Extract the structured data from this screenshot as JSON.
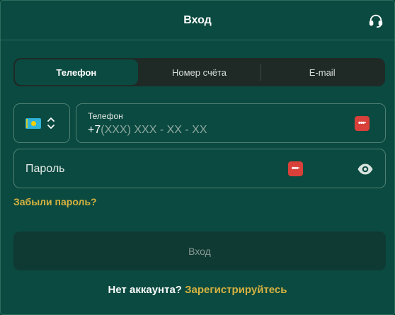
{
  "header": {
    "title": "Вход",
    "support_icon": "headset-icon"
  },
  "tabs": [
    {
      "label": "Телефон",
      "active": true
    },
    {
      "label": "Номер счёта",
      "active": false
    },
    {
      "label": "E-mail",
      "active": false
    }
  ],
  "country_select": {
    "flag": "kazakhstan-flag",
    "icon": "chevron-updown-icon"
  },
  "phone_field": {
    "label": "Телефон",
    "prefix": "+7",
    "mask": "(XXX) XXX - XX - XX",
    "manager_icon": "password-manager-icon"
  },
  "password_field": {
    "placeholder": "Пароль",
    "manager_icon": "password-manager-icon",
    "visibility_icon": "eye-icon"
  },
  "forgot_link": "Забыли пароль?",
  "login_button": "Вход",
  "signup": {
    "question": "Нет аккаунта?",
    "link": "Зарегистрируйтесь"
  },
  "colors": {
    "background": "#0b4a40",
    "accent": "#d6b240",
    "tabs_bg": "#1f2a27",
    "button_bg": "#0f3a33"
  }
}
